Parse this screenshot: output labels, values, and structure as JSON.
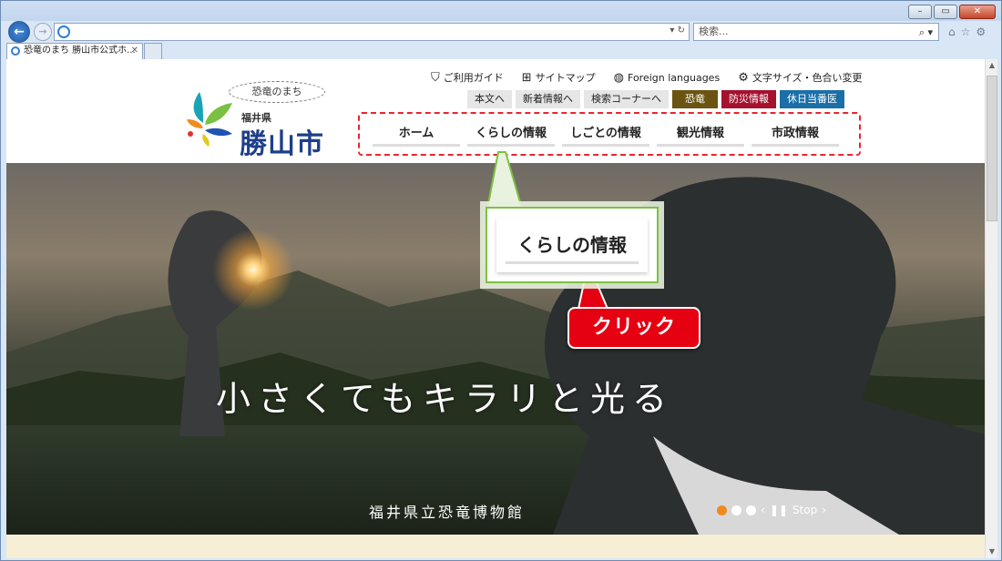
{
  "browser": {
    "tab_title": "恐竜のまち 勝山市公式ホ...",
    "search_placeholder": "検索...",
    "address_value": ""
  },
  "site": {
    "logo_tagline": "恐竜のまち",
    "logo_prefecture": "福井県",
    "logo_city": "勝山市",
    "util_links": [
      {
        "label": "ご利用ガイド",
        "icon": "shield-icon"
      },
      {
        "label": "サイトマップ",
        "icon": "sitemap-icon"
      },
      {
        "label": "Foreign languages",
        "icon": "globe-icon"
      },
      {
        "label": "文字サイズ・色合い変更",
        "icon": "settings-icon"
      }
    ],
    "quick_buttons": [
      "本文へ",
      "新着情報へ",
      "検索コーナーへ",
      "恐竜",
      "防災情報",
      "休日当番医"
    ],
    "global_nav": [
      "ホーム",
      "くらしの情報",
      "しごとの情報",
      "観光情報",
      "市政情報"
    ]
  },
  "hero": {
    "tagline": "小さくてもキラリと光る",
    "caption": "福井県立恐竜博物館",
    "carousel_stop": "Stop"
  },
  "callouts": {
    "zoom_label": "くらしの情報",
    "click_label": "クリック"
  },
  "colors": {
    "highlight_dash": "#e8262e",
    "callout_red": "#e50012",
    "zoom_border": "#7cc142"
  }
}
